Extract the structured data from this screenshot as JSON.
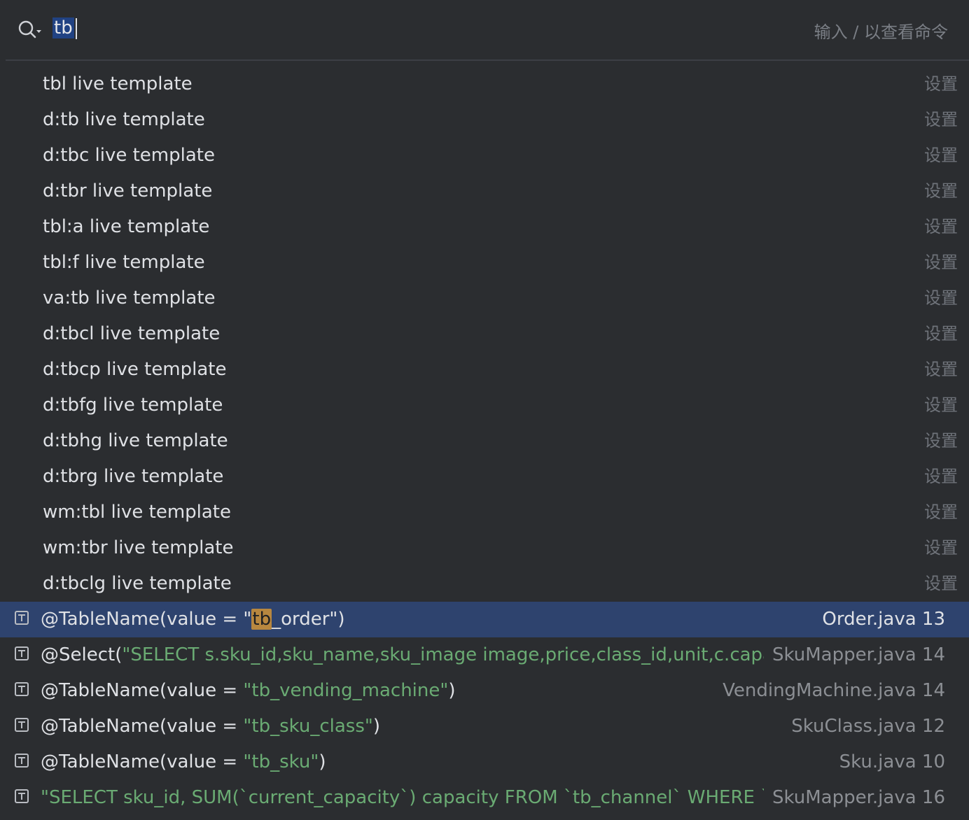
{
  "search": {
    "query": "tb",
    "hint": "输入 / 以查看命令"
  },
  "templates": [
    {
      "label": "tbl live template",
      "action": "设置"
    },
    {
      "label": "d:tb live template",
      "action": "设置"
    },
    {
      "label": "d:tbc live template",
      "action": "设置"
    },
    {
      "label": "d:tbr live template",
      "action": "设置"
    },
    {
      "label": "tbl:a live template",
      "action": "设置"
    },
    {
      "label": "tbl:f live template",
      "action": "设置"
    },
    {
      "label": "va:tb live template",
      "action": "设置"
    },
    {
      "label": "d:tbcl live template",
      "action": "设置"
    },
    {
      "label": "d:tbcp live template",
      "action": "设置"
    },
    {
      "label": "d:tbfg live template",
      "action": "设置"
    },
    {
      "label": "d:tbhg live template",
      "action": "设置"
    },
    {
      "label": "d:tbrg live template",
      "action": "设置"
    },
    {
      "label": "wm:tbl live template",
      "action": "设置"
    },
    {
      "label": "wm:tbr live template",
      "action": "设置"
    },
    {
      "label": "d:tbclg live template",
      "action": "设置"
    }
  ],
  "code_results": [
    {
      "prefix": "@TableName(value = ",
      "string_pre": "\"",
      "string_hl": "tb",
      "string_post": "_order\"",
      "suffix": ")",
      "file": "Order.java 13",
      "icon": "text-icon",
      "selected": true
    },
    {
      "prefix": "@Select(",
      "string_pre": "\"SELECT s.sku_id,sku_name,sku_image image,price,class_id,unit,c.capacity FRO",
      "string_hl": "",
      "string_post": "",
      "suffix": "",
      "file": "SkuMapper.java 14",
      "icon": "text-icon",
      "selected": false
    },
    {
      "prefix": "@TableName(value = ",
      "string_pre": "\"tb_vending_machine\"",
      "string_hl": "",
      "string_post": "",
      "suffix": ")",
      "file": "VendingMachine.java 14",
      "icon": "text-icon",
      "selected": false
    },
    {
      "prefix": "@TableName(value = ",
      "string_pre": "\"tb_sku_class\"",
      "string_hl": "",
      "string_post": "",
      "suffix": ")",
      "file": "SkuClass.java 12",
      "icon": "text-icon",
      "selected": false
    },
    {
      "prefix": "@TableName(value = ",
      "string_pre": "\"tb_sku\"",
      "string_hl": "",
      "string_post": "",
      "suffix": ")",
      "file": "Sku.java 10",
      "icon": "text-icon",
      "selected": false
    },
    {
      "prefix": "",
      "string_pre": "\"SELECT sku_id, SUM(`current_capacity`) capacity  FROM `tb_channel` WHERE `inner_co",
      "string_hl": "",
      "string_post": "",
      "suffix": "",
      "file": "SkuMapper.java 16",
      "icon": "text-icon",
      "selected": false
    }
  ]
}
